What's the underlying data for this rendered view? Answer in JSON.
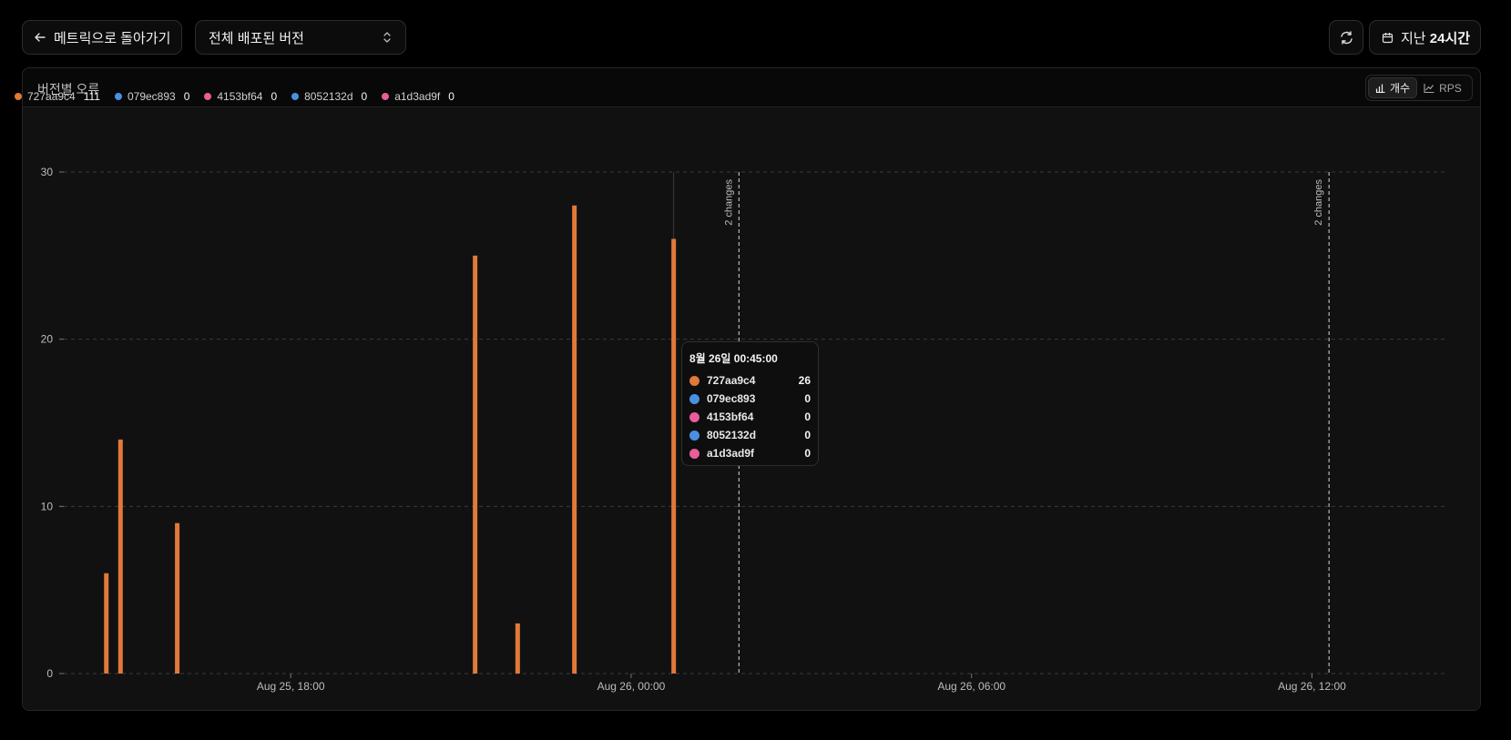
{
  "toolbar": {
    "back_label": "메트릭으로 돌아가기",
    "version_select_value": "전체 배포된 버전",
    "range_label_prefix": "지난 ",
    "range_label_bold": "24시간"
  },
  "panel": {
    "title": "버전별 오류",
    "toggle_count_label": "개수",
    "toggle_rps_label": "RPS"
  },
  "legend": [
    {
      "name": "727aa9c4",
      "value": "111",
      "color": "#e0793a"
    },
    {
      "name": "079ec893",
      "value": "0",
      "color": "#4a90e2"
    },
    {
      "name": "4153bf64",
      "value": "0",
      "color": "#e85d9a"
    },
    {
      "name": "8052132d",
      "value": "0",
      "color": "#4a90e2"
    },
    {
      "name": "a1d3ad9f",
      "value": "0",
      "color": "#e85d9a"
    }
  ],
  "tooltip": {
    "title": "8월 26일 00:45:00",
    "rows": [
      {
        "name": "727aa9c4",
        "value": "26",
        "color": "#e0793a"
      },
      {
        "name": "079ec893",
        "value": "0",
        "color": "#4a90e2"
      },
      {
        "name": "4153bf64",
        "value": "0",
        "color": "#e85d9a"
      },
      {
        "name": "8052132d",
        "value": "0",
        "color": "#4a90e2"
      },
      {
        "name": "a1d3ad9f",
        "value": "0",
        "color": "#e85d9a"
      }
    ]
  },
  "chart_data": {
    "type": "bar",
    "title": "버전별 오류",
    "xlabel": "",
    "ylabel": "",
    "ylim": [
      0,
      30
    ],
    "yticks": [
      0,
      10,
      20,
      30
    ],
    "xlim_hours_from_aug25_00": [
      14.0,
      38.4
    ],
    "xticks": [
      {
        "label": "Aug 25, 18:00",
        "hours_from_aug25_00": 18
      },
      {
        "label": "Aug 26, 00:00",
        "hours_from_aug25_00": 24
      },
      {
        "label": "Aug 26, 06:00",
        "hours_from_aug25_00": 30
      },
      {
        "label": "Aug 26, 12:00",
        "hours_from_aug25_00": 36
      }
    ],
    "grid": true,
    "legend_position": "top-left",
    "series": [
      {
        "name": "727aa9c4",
        "color": "#e0793a",
        "points": [
          {
            "time": "Aug 25, 14:45",
            "hours_from_aug25_00": 14.75,
            "value": 6
          },
          {
            "time": "Aug 25, 15:00",
            "hours_from_aug25_00": 15.0,
            "value": 14
          },
          {
            "time": "Aug 25, 16:00",
            "hours_from_aug25_00": 16.0,
            "value": 9
          },
          {
            "time": "Aug 25, 21:15",
            "hours_from_aug25_00": 21.25,
            "value": 25
          },
          {
            "time": "Aug 25, 22:00",
            "hours_from_aug25_00": 22.0,
            "value": 3
          },
          {
            "time": "Aug 25, 23:00",
            "hours_from_aug25_00": 23.0,
            "value": 28
          },
          {
            "time": "Aug 26, 00:45",
            "hours_from_aug25_00": 24.75,
            "value": 26
          }
        ]
      },
      {
        "name": "079ec893",
        "color": "#4a90e2",
        "points": []
      },
      {
        "name": "4153bf64",
        "color": "#e85d9a",
        "points": []
      },
      {
        "name": "8052132d",
        "color": "#4a90e2",
        "points": []
      },
      {
        "name": "a1d3ad9f",
        "color": "#e85d9a",
        "points": []
      }
    ],
    "annotations": [
      {
        "label": "2 changes",
        "hours_from_aug25_00": 25.9
      },
      {
        "label": "2 changes",
        "hours_from_aug25_00": 36.3
      }
    ],
    "hover_hours_from_aug25_00": 24.75
  }
}
